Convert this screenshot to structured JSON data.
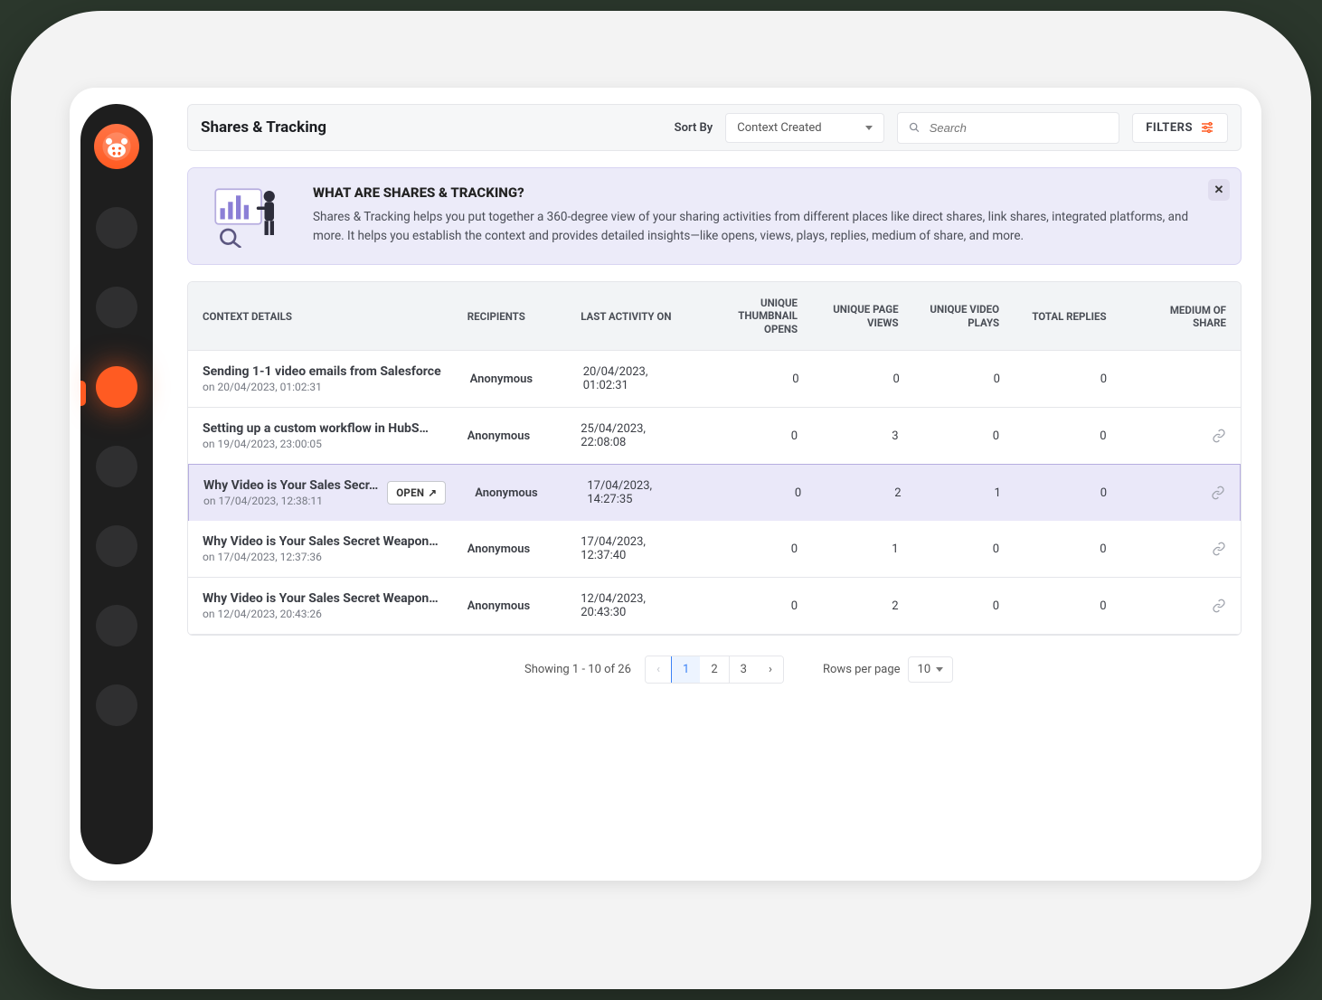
{
  "sidebar": {
    "item_count": 7,
    "active_index": 2
  },
  "header": {
    "title": "Shares & Tracking",
    "sort_label": "Sort By",
    "sort_value": "Context Created",
    "search_placeholder": "Search",
    "filters_label": "FILTERS"
  },
  "banner": {
    "title": "WHAT ARE SHARES & TRACKING?",
    "body": "Shares & Tracking helps you put together a 360-degree view of your sharing activities from different places like direct shares, link shares, integrated platforms, and more. It helps you establish the context and provides detailed insights—like opens, views, plays, replies, medium of share, and more."
  },
  "columns": {
    "context": "CONTEXT DETAILS",
    "recipients": "RECIPIENTS",
    "last_activity": "LAST ACTIVITY ON",
    "thumb_opens": "UNIQUE THUMBNAIL OPENS",
    "page_views": "UNIQUE PAGE VIEWS",
    "video_plays": "UNIQUE VIDEO PLAYS",
    "total_replies": "TOTAL REPLIES",
    "medium": "MEDIUM OF SHARE"
  },
  "open_chip_label": "OPEN",
  "rows": [
    {
      "title": "Sending 1-1 video emails from Salesforce",
      "timestamp": "on 20/04/2023, 01:02:31",
      "recipients": "Anonymous",
      "last_activity": "20/04/2023, 01:02:31",
      "thumb_opens": "0",
      "page_views": "0",
      "video_plays": "0",
      "total_replies": "0",
      "medium_icon": false,
      "highlighted": false,
      "open_visible": false
    },
    {
      "title": "Setting up a custom workflow in HubS…",
      "timestamp": "on 19/04/2023, 23:00:05",
      "recipients": "Anonymous",
      "last_activity": "25/04/2023, 22:08:08",
      "thumb_opens": "0",
      "page_views": "3",
      "video_plays": "0",
      "total_replies": "0",
      "medium_icon": true,
      "highlighted": false,
      "open_visible": false
    },
    {
      "title": "Why Video is Your Sales Secr…",
      "timestamp": "on 17/04/2023, 12:38:11",
      "recipients": "Anonymous",
      "last_activity": "17/04/2023, 14:27:35",
      "thumb_opens": "0",
      "page_views": "2",
      "video_plays": "1",
      "total_replies": "0",
      "medium_icon": true,
      "highlighted": true,
      "open_visible": true
    },
    {
      "title": "Why Video is Your Sales Secret Weapon…",
      "timestamp": "on 17/04/2023, 12:37:36",
      "recipients": "Anonymous",
      "last_activity": "17/04/2023, 12:37:40",
      "thumb_opens": "0",
      "page_views": "1",
      "video_plays": "0",
      "total_replies": "0",
      "medium_icon": true,
      "highlighted": false,
      "open_visible": false
    },
    {
      "title": "Why Video is Your Sales Secret Weapon…",
      "timestamp": "on 12/04/2023, 20:43:26",
      "recipients": "Anonymous",
      "last_activity": "12/04/2023, 20:43:30",
      "thumb_opens": "0",
      "page_views": "2",
      "video_plays": "0",
      "total_replies": "0",
      "medium_icon": true,
      "highlighted": false,
      "open_visible": false
    }
  ],
  "pagination": {
    "showing": "Showing 1 - 10 of 26",
    "pages": [
      "1",
      "2",
      "3"
    ],
    "active_page": "1",
    "rows_per_page_label": "Rows per page",
    "rows_per_page_value": "10"
  }
}
